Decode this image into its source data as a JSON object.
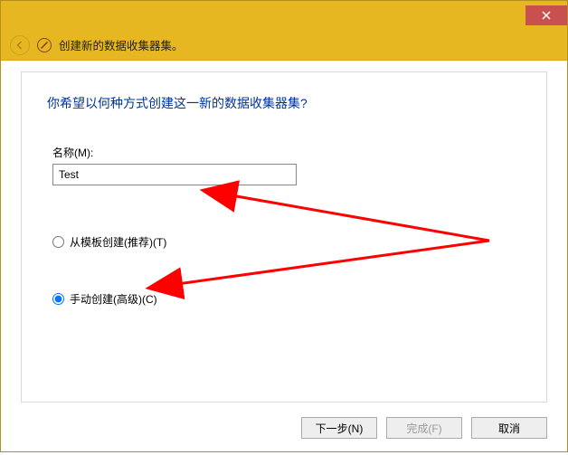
{
  "titlebar": {
    "close_tooltip": "Close"
  },
  "header": {
    "title": "创建新的数据收集器集。"
  },
  "main": {
    "question": "你希望以何种方式创建这一新的数据收集器集?",
    "name_label": "名称(M):",
    "name_value": "Test",
    "radio_template": "从模板创建(推荐)(T)",
    "radio_manual": "手动创建(高级)(C)",
    "selected_radio": "manual"
  },
  "buttons": {
    "next": "下一步(N)",
    "finish": "完成(F)",
    "cancel": "取消"
  },
  "colors": {
    "accent": "#e7b721",
    "close": "#c8504e",
    "heading": "#003399",
    "annotation": "#ff0000"
  }
}
